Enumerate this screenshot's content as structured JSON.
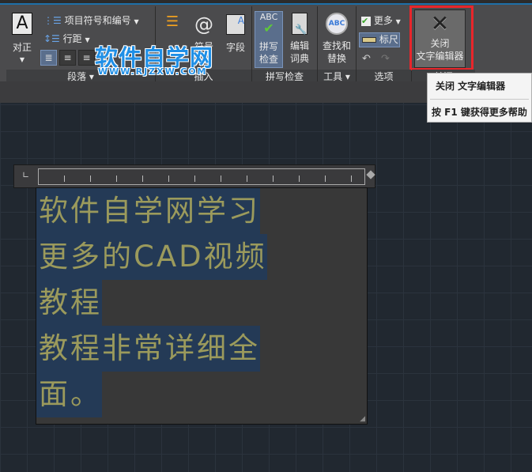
{
  "ribbon": {
    "justify": {
      "label": "对正"
    },
    "bullets": {
      "label": "项目符号和编号"
    },
    "line_spacing": {
      "label": "行距"
    },
    "paragraph_panel": "段落",
    "insert": {
      "symbol": "符号",
      "field": "字段",
      "panel": "插入"
    },
    "spell": {
      "check": [
        "拼写",
        "检查"
      ],
      "dictionary": [
        "编辑",
        "词典"
      ],
      "panel": "拼写检查"
    },
    "tools": {
      "find": [
        "查找和",
        "替换"
      ],
      "panel": "工具"
    },
    "options": {
      "more": "更多",
      "ruler": "标尺",
      "panel": "选项"
    },
    "close": {
      "label": [
        "关闭",
        "文字编辑器"
      ],
      "panel": "关闭"
    }
  },
  "watermark": {
    "title": "软件自学网",
    "url": "WWW.RJZXW.COM"
  },
  "tooltip": {
    "title": "关闭 文字编辑器",
    "help": "按 F1 键获得更多帮助"
  },
  "editor": {
    "lines": [
      "软件自学网学习",
      "更多的CAD视频",
      "教程",
      "教程非常详细全",
      "面。"
    ]
  },
  "colors": {
    "accent": "#1e6fa8",
    "highlight": "#243a56",
    "text": "#9b9a5c",
    "close_outline": "#e8262b"
  }
}
